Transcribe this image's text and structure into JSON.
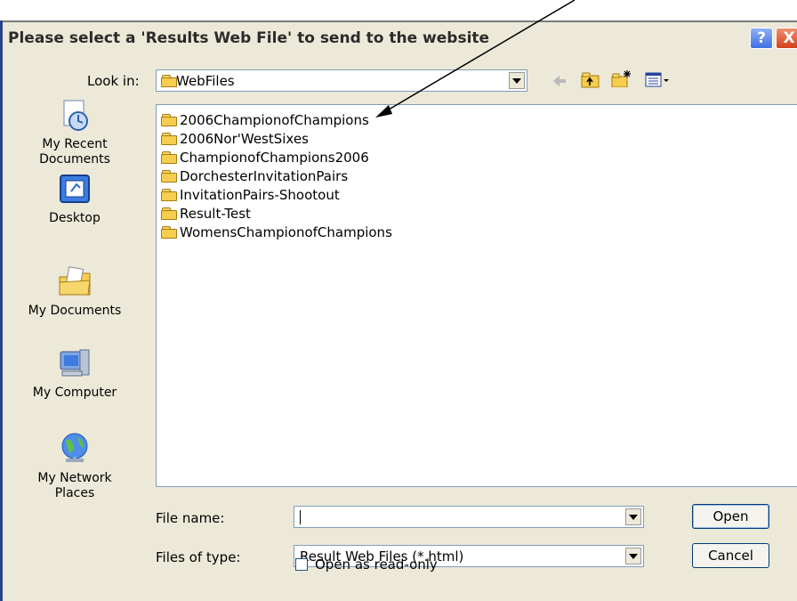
{
  "window": {
    "title": "Please select a 'Results Web File' to send to the website"
  },
  "look_in": {
    "label": "Look in:",
    "value": "WebFiles"
  },
  "places": [
    {
      "label": "My Recent\nDocuments",
      "icon": "recent-documents-icon"
    },
    {
      "label": "Desktop",
      "icon": "desktop-icon"
    },
    {
      "label": "My Documents",
      "icon": "my-documents-icon"
    },
    {
      "label": "My Computer",
      "icon": "my-computer-icon"
    },
    {
      "label": "My Network\nPlaces",
      "icon": "network-places-icon"
    }
  ],
  "files": [
    "2006ChampionofChampions",
    "2006Nor'WestSixes",
    "ChampionofChampions2006",
    "DorchesterInvitationPairs",
    "InvitationPairs-Shootout",
    "Result-Test",
    "WomensChampionofChampions"
  ],
  "file_name": {
    "label": "File name:",
    "value": ""
  },
  "file_type": {
    "label": "Files of type:",
    "value": "Result Web Files (*.html)"
  },
  "read_only": {
    "label": "Open as read-only",
    "checked": false
  },
  "buttons": {
    "open": "Open",
    "cancel": "Cancel",
    "help": "?",
    "close": "X"
  },
  "colors": {
    "titlebar_accent": "#27408b",
    "dialog_bg": "#ece9d8",
    "folder": "#f6cd4f"
  }
}
